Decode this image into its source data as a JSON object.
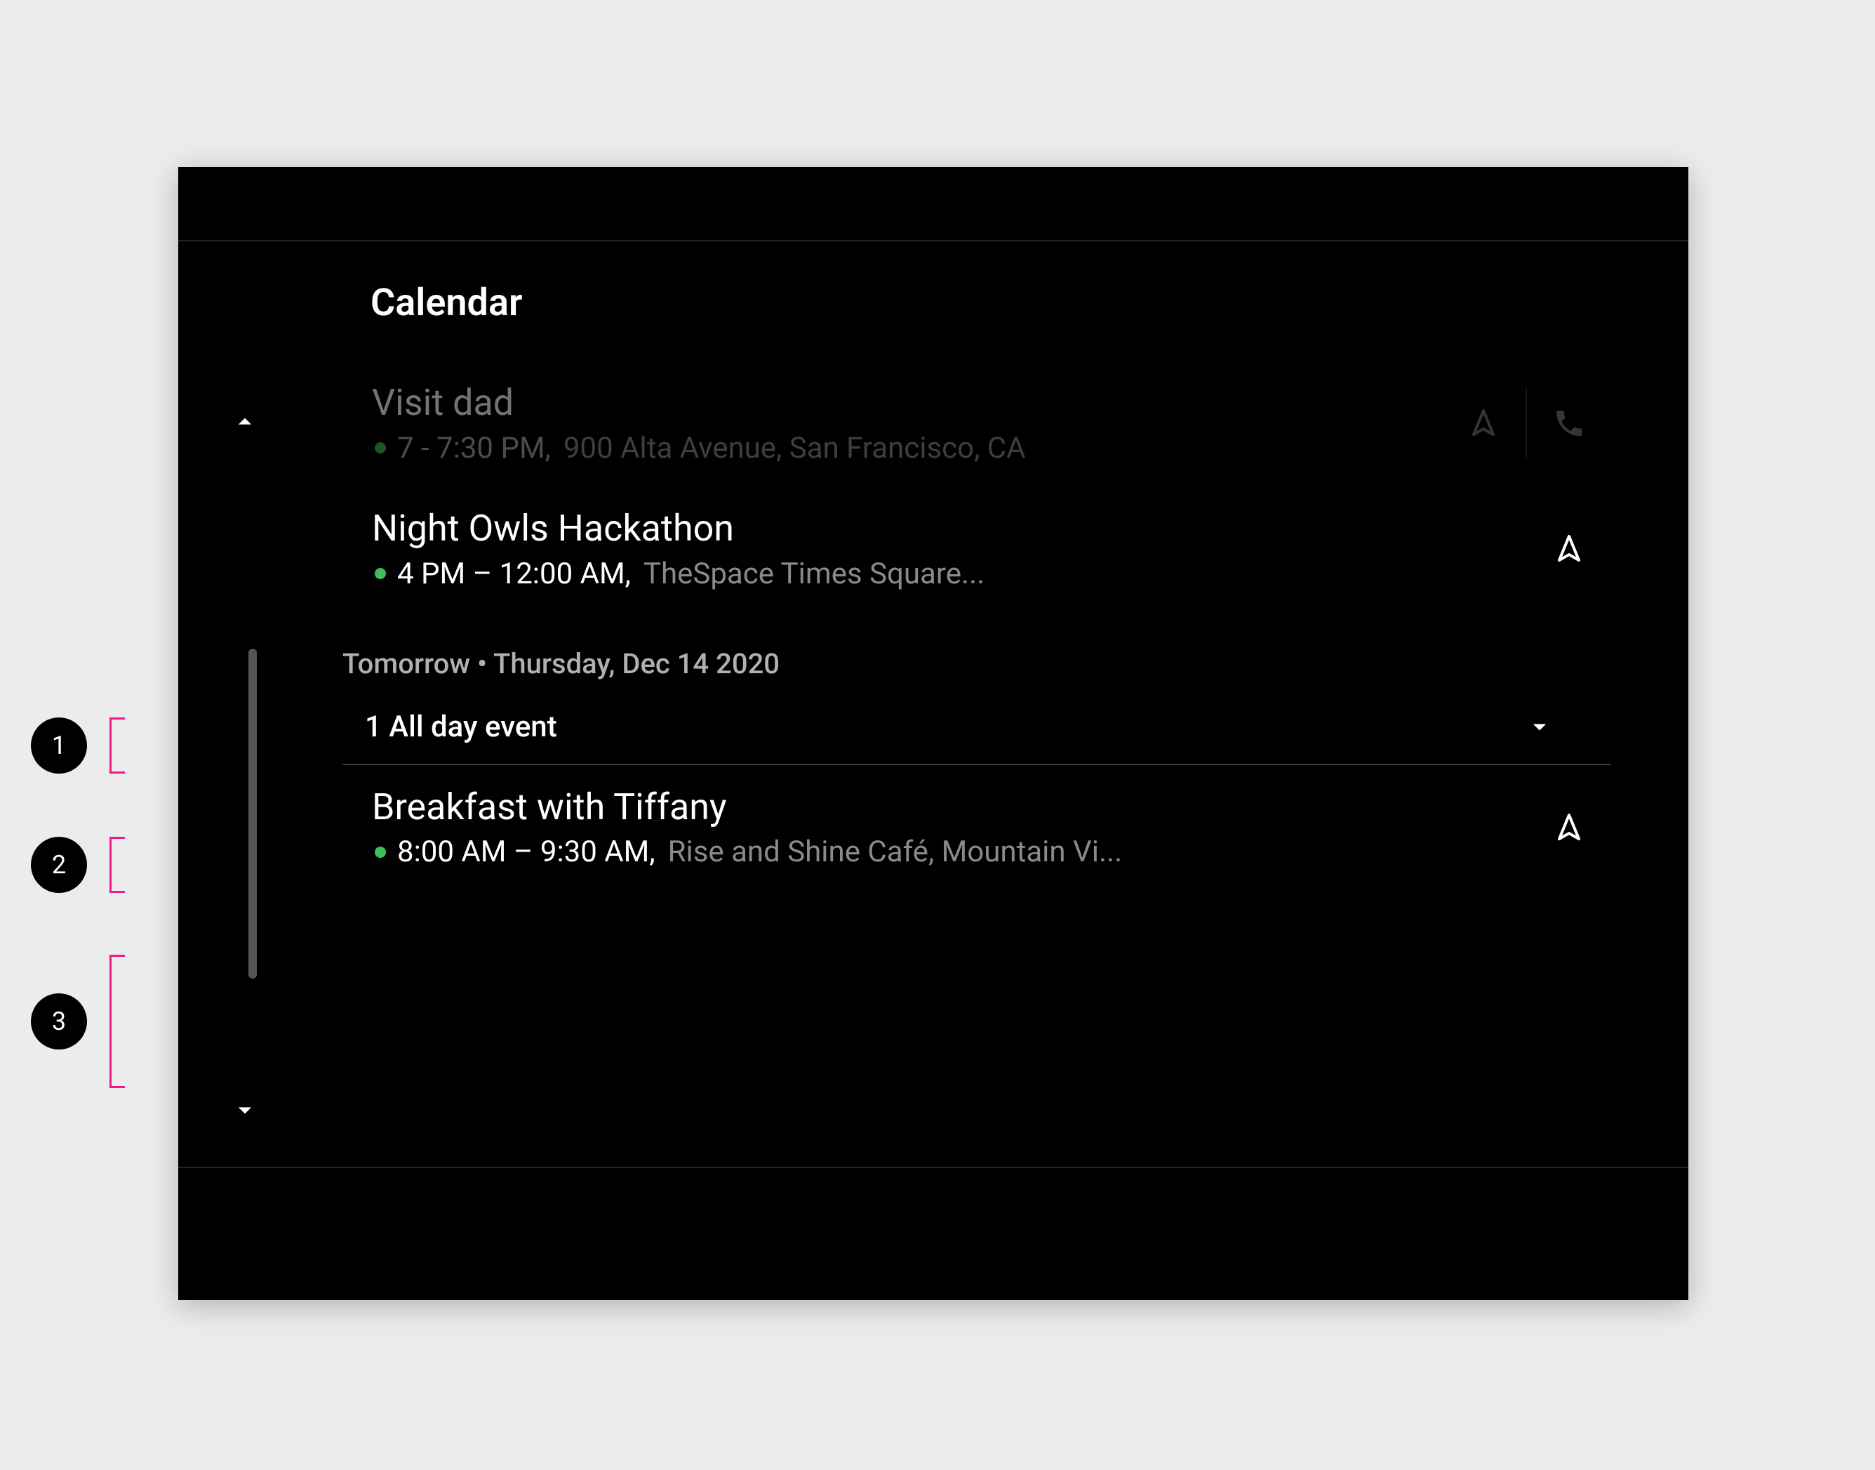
{
  "app": {
    "title": "Calendar"
  },
  "annotations": {
    "a1": "1",
    "a2": "2",
    "a3": "3"
  },
  "section": {
    "header": "Tomorrow • Thursday, Dec 14 2020",
    "allday_label": "1 All day event"
  },
  "events": [
    {
      "title": "Visit dad",
      "time": "7 - 7:30 PM,",
      "location": "900 Alta Avenue, San Francisco, CA",
      "dimmed": true,
      "nav": true,
      "call": true
    },
    {
      "title": "Night Owls Hackathon",
      "time": "4 PM – 12:00 AM,",
      "location": "TheSpace Times Square...",
      "dimmed": false,
      "nav": true,
      "call": false
    },
    {
      "title": "Breakfast with Tiffany",
      "time": "8:00 AM – 9:30 AM,",
      "location": "Rise and Shine Café, Mountain Vi...",
      "dimmed": false,
      "nav": true,
      "call": false
    }
  ]
}
